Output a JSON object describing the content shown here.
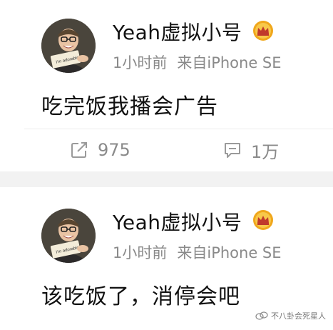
{
  "posts": [
    {
      "username": "Yeah虚拟小号",
      "time": "1小时前",
      "source": "来自iPhone SE",
      "content": "吃完饭我播会广告",
      "reposts": "975",
      "comments": "1万",
      "avatar_sign_text": "I'm adorable!"
    },
    {
      "username": "Yeah虚拟小号",
      "time": "1小时前",
      "source": "来自iPhone SE",
      "content": "该吃饭了，消停会吧",
      "avatar_sign_text": "I'm adorable!"
    }
  ],
  "watermark": {
    "text": "不八卦会死星人"
  },
  "colors": {
    "badge": "#f0a71c",
    "meta": "#8a8a8a",
    "divider_band": "#f2f2f2"
  },
  "icons": [
    "avatar",
    "crown-badge-icon",
    "repost-icon",
    "comment-icon",
    "watermark-icon"
  ]
}
